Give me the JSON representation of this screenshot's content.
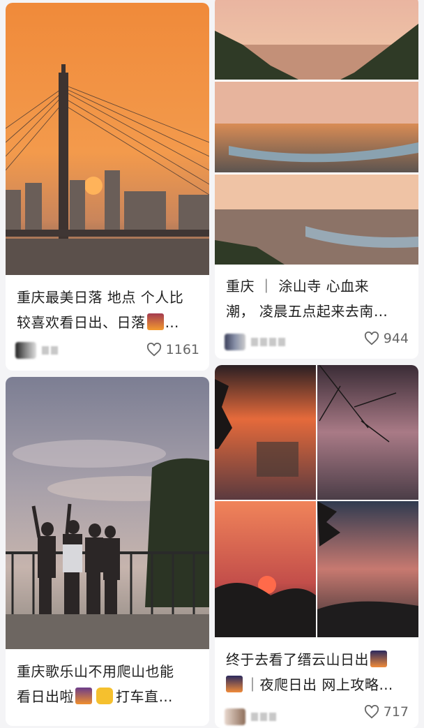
{
  "feed": [
    {
      "title_line1": "重庆最美日落 地点 个人比",
      "title_line2": "较喜欢看日出、日落",
      "likes": "1161",
      "image": "sunset-bridge-photo"
    },
    {
      "title_line1": "重庆 ｜ 涂山寺 心血来",
      "title_line2": "潮， 凌晨五点起来去南…",
      "likes": "944",
      "image": "city-panorama-photos"
    },
    {
      "title_line1": "重庆歌乐山不用爬山也能",
      "title_line2": "看日出啦",
      "title_line2b": "打车直…",
      "likes": "",
      "image": "friends-silhouette-photo"
    },
    {
      "title_line1": "终于去看了缙云山日出",
      "title_line2": "｜夜爬日出 网上攻略…",
      "likes": "717",
      "image": "sunrise-collage-photo"
    }
  ],
  "ellipsis": "…",
  "icons": [
    "heart-icon",
    "sunset-emoji",
    "taxi-emoji",
    "sunrise-emoji"
  ]
}
